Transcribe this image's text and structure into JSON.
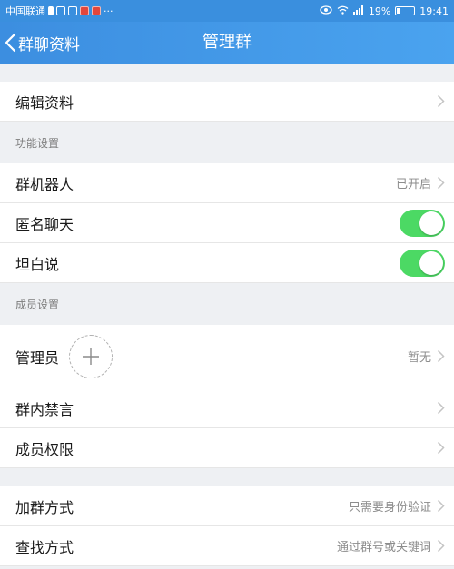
{
  "status_bar": {
    "carrier": "中国联通",
    "notification_ellipsis": "···",
    "battery_percent": "19%",
    "time": "19:41"
  },
  "nav": {
    "back_label": "群聊资料",
    "title": "管理群"
  },
  "rows": {
    "edit_profile": "编辑资料",
    "section_functions": "功能设置",
    "group_robot": "群机器人",
    "group_robot_value": "已开启",
    "anonymous_chat": "匿名聊天",
    "anonymous_chat_on": true,
    "candid_talk": "坦白说",
    "candid_talk_on": true,
    "section_members": "成员设置",
    "admin": "管理员",
    "admin_value": "暂无",
    "group_mute": "群内禁言",
    "member_permissions": "成员权限",
    "join_method": "加群方式",
    "join_method_value": "只需要身份验证",
    "search_method": "查找方式",
    "search_method_value": "通过群号或关键词"
  },
  "colors": {
    "accent": "#3c8ee0",
    "toggle_on": "#4cd964"
  }
}
